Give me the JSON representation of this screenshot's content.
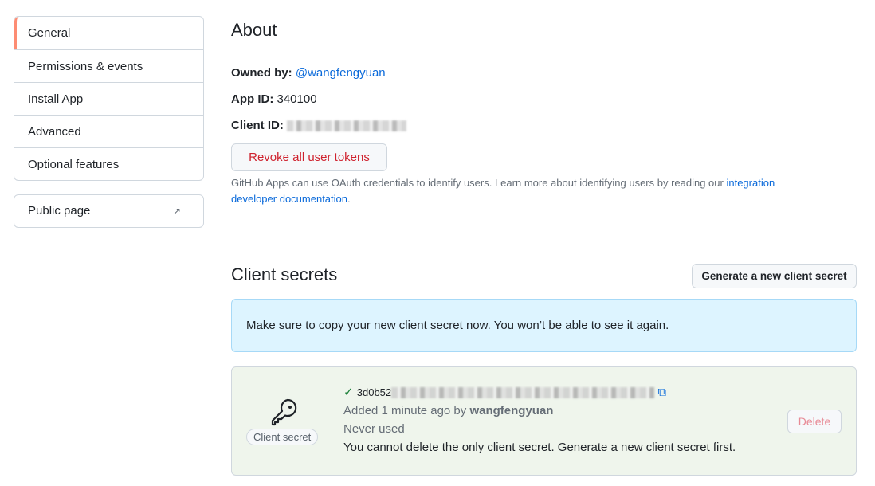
{
  "sidebar": {
    "items": [
      {
        "label": "General"
      },
      {
        "label": "Permissions & events"
      },
      {
        "label": "Install App"
      },
      {
        "label": "Advanced"
      },
      {
        "label": "Optional features"
      }
    ],
    "public_page": "Public page"
  },
  "about": {
    "title": "About",
    "owned_by_label": "Owned by:",
    "owner": "@wangfengyuan",
    "app_id_label": "App ID:",
    "app_id": "340100",
    "client_id_label": "Client ID:",
    "revoke_button": "Revoke all user tokens",
    "note": "GitHub Apps can use OAuth credentials to identify users. Learn more about identifying users by reading our ",
    "note_link": "integration developer documentation",
    "note_end": "."
  },
  "secrets": {
    "title": "Client secrets",
    "generate_button": "Generate a new client secret",
    "flash": "Make sure to copy your new client secret now. You won’t be able to see it again.",
    "badge": "Client secret",
    "added_prefix": "Added 1 minute ago by ",
    "added_by": "wangfengyuan",
    "usage": "Never used",
    "warning": "You cannot delete the only client secret. Generate a new client secret first.",
    "delete_button": "Delete",
    "secret_prefix": "3d0b52"
  },
  "colors": {
    "accent": "#fd8c73",
    "link": "#0969da",
    "danger": "#cf222e",
    "success": "#1a7f37"
  }
}
